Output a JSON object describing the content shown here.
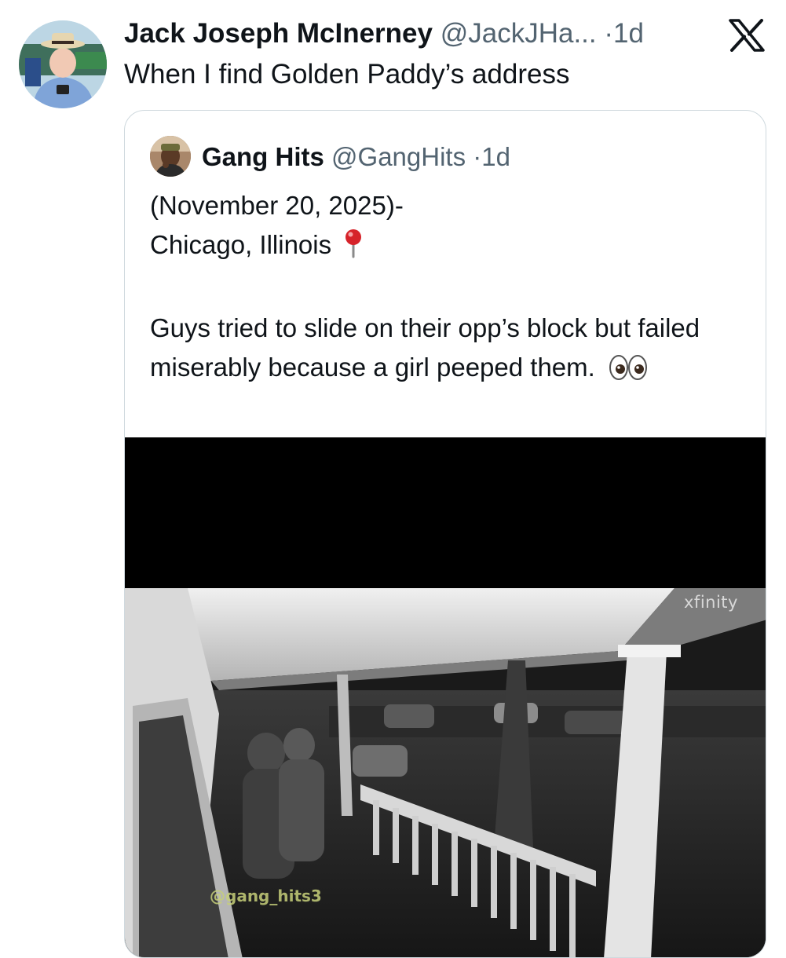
{
  "tweet": {
    "author_name": "Jack Joseph McInerney",
    "author_handle": "@JackJHa...",
    "separator": "·",
    "timestamp": "1d",
    "text": "When I find Golden Paddy’s address",
    "platform_icon": "x-logo-icon"
  },
  "quote": {
    "author_name": "Gang Hits",
    "author_handle": "@GangHits",
    "separator": "·",
    "timestamp": "1d",
    "lines": [
      "(November 20, 2025)-",
      "Chicago, Illinois",
      "Guys tried to slide on their opp’s block but failed miserably because a girl peeped them."
    ],
    "media": {
      "brand_overlay": "xfinity",
      "watermark": "@gang_hits3"
    }
  },
  "icons": {
    "location": "round-pushpin-icon",
    "eyes": "eyes-icon"
  },
  "colors": {
    "text_primary": "#0f1419",
    "text_secondary": "#536471",
    "card_border": "#cfd9de",
    "pin_red": "#d6232a"
  }
}
